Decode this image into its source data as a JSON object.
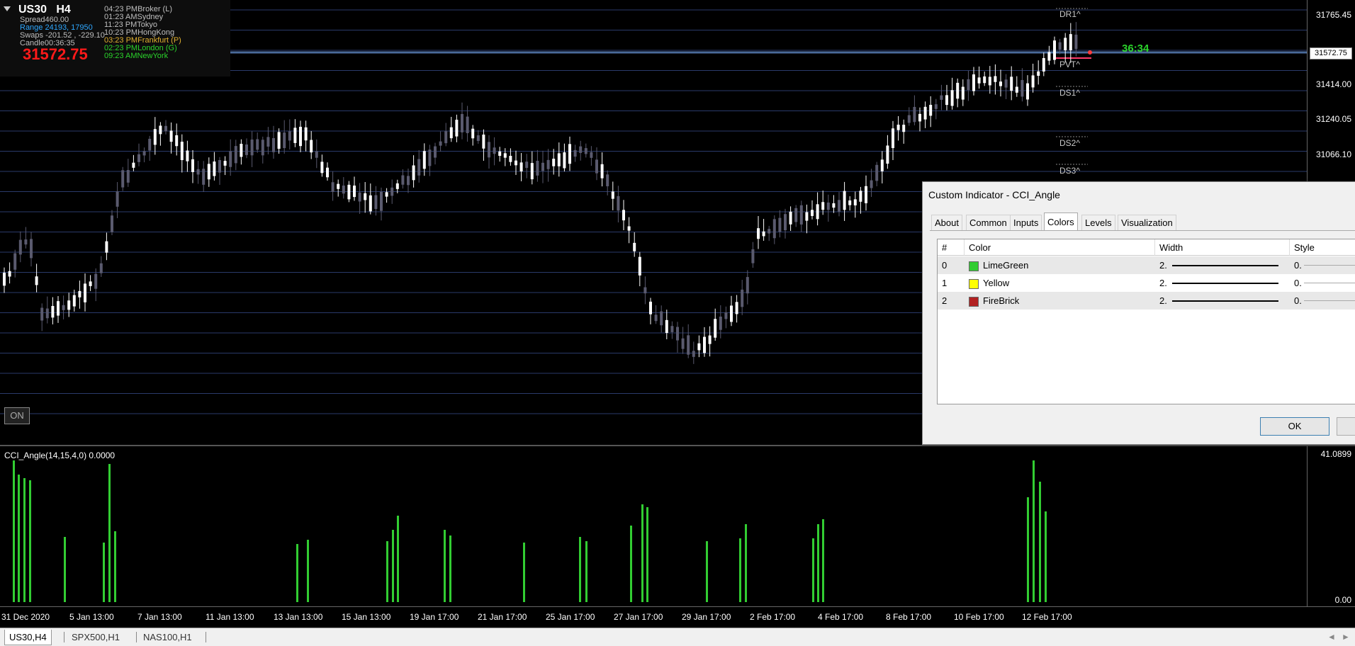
{
  "symbol": {
    "name": "US30",
    "timeframe": "H4"
  },
  "info": [
    {
      "label": "Spread",
      "value": "460.00",
      "color": "#bfbfbf"
    },
    {
      "label": "Range",
      "value": "24193, 17950",
      "color": "#2fa8ff"
    },
    {
      "label": "Tokyo",
      "value": "",
      "color": "#bfbfbf"
    },
    {
      "label": "Swaps",
      "value": "-201.52 , -229.10",
      "color": "#bfbfbf"
    },
    {
      "label": "Candle",
      "value": "00:36:35",
      "color": "#bfbfbf"
    }
  ],
  "info_text": {
    "spread": "Spread460.00",
    "range": "Range 24193, 17950",
    "swaps": "Swaps -201.52 , -229.10",
    "candle": "Candle00:36:35"
  },
  "price_big": "31572.75",
  "clocks": [
    {
      "time": "04:23 PM",
      "city": "Broker  (L)",
      "color": "#bfbfbf"
    },
    {
      "time": "01:23 AM",
      "city": "Sydney",
      "color": "#bfbfbf"
    },
    {
      "time": "11:23 PM",
      "city": "Tokyo",
      "color": "#bfbfbf"
    },
    {
      "time": "10:23 PM",
      "city": "HongKong",
      "color": "#bfbfbf"
    },
    {
      "time": "03:23 PM",
      "city": "Frankfurt  (P)",
      "color": "#e0b030"
    },
    {
      "time": "02:23 PM",
      "city": "London  (G)",
      "color": "#2bd42b"
    },
    {
      "time": "09:23 AM",
      "city": "NewYork",
      "color": "#2bd42b"
    }
  ],
  "pivots": [
    "DR1^",
    "PVT^",
    "DS1^",
    "DS2^",
    "DS3^"
  ],
  "timer": "36:34",
  "current_price_tag": "31572.75",
  "price_axis": [
    "31765.45",
    "31414.00",
    "31240.05",
    "31066.10"
  ],
  "on_button": "ON",
  "indicator": {
    "title": "CCI_Angle(14,15,4,0) 0.0000",
    "axis_top": "41.0899",
    "axis_bottom": "0.00"
  },
  "time_axis": [
    "31 Dec 2020",
    "5 Jan 13:00",
    "7 Jan 13:00",
    "11 Jan 13:00",
    "13 Jan 13:00",
    "15 Jan 13:00",
    "19 Jan 17:00",
    "21 Jan 17:00",
    "25 Jan 17:00",
    "27 Jan 17:00",
    "29 Jan 17:00",
    "2 Feb 17:00",
    "4 Feb 17:00",
    "8 Feb 17:00",
    "10 Feb 17:00",
    "12 Feb 17:00"
  ],
  "dialog": {
    "title": "Custom Indicator - CCI_Angle",
    "tabs": [
      "About",
      "Common",
      "Inputs",
      "Colors",
      "Levels",
      "Visualization"
    ],
    "active_tab": "Colors",
    "columns": [
      "#",
      "Color",
      "Width",
      "Style"
    ],
    "rows": [
      {
        "index": "0",
        "color_name": "LimeGreen",
        "swatch": "#32cd32",
        "width": "2.",
        "style": "0."
      },
      {
        "index": "1",
        "color_name": "Yellow",
        "swatch": "#ffff00",
        "width": "2.",
        "style": "0."
      },
      {
        "index": "2",
        "color_name": "FireBrick",
        "swatch": "#b22222",
        "width": "2.",
        "style": "0."
      }
    ],
    "ok_label": "OK"
  },
  "bottom_tabs": [
    "US30,H4",
    "SPX500,H1",
    "NAS100,H1"
  ],
  "colors": {
    "bull": "#ffffff",
    "bear": "#5a5a6e",
    "histogram": "#32cd32",
    "grid": "#2a3a6a"
  }
}
